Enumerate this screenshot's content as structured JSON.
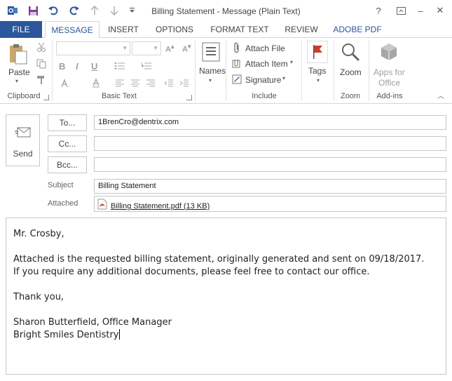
{
  "window": {
    "title": "Billing Statement - Message (Plain Text)",
    "help": "?",
    "minimize": "–",
    "close": "✕"
  },
  "tabs": [
    {
      "label": "FILE"
    },
    {
      "label": "MESSAGE"
    },
    {
      "label": "INSERT"
    },
    {
      "label": "OPTIONS"
    },
    {
      "label": "FORMAT TEXT"
    },
    {
      "label": "REVIEW"
    },
    {
      "label": "ADOBE PDF"
    }
  ],
  "ribbon": {
    "clipboard": {
      "paste": "Paste",
      "group": "Clipboard"
    },
    "basic_text": {
      "bold": "B",
      "italic": "I",
      "underline": "U",
      "group": "Basic Text"
    },
    "names": {
      "label": "Names"
    },
    "include": {
      "attach_file": "Attach File",
      "attach_item": "Attach Item",
      "signature": "Signature",
      "group": "Include"
    },
    "tags": {
      "label": "Tags"
    },
    "zoom": {
      "label": "Zoom",
      "group": "Zoom"
    },
    "addins": {
      "label1": "Apps for",
      "label2": "Office",
      "group": "Add-ins"
    }
  },
  "header": {
    "send": "Send",
    "to_button": "To...",
    "cc_button": "Cc...",
    "bcc_button": "Bcc...",
    "to_value": "1BrenCro@dentrix.com",
    "cc_value": "",
    "bcc_value": "",
    "subject_label": "Subject",
    "subject_value": "Billing Statement",
    "attached_label": "Attached",
    "attachment": "Billing Statement.pdf (13 KB)"
  },
  "body": {
    "line1": "Mr. Crosby,",
    "line2": "Attached is the requested billing statement, originally generated and sent on 09/18/2017.",
    "line3": "If you require any additional documents, please feel free to contact our office.",
    "line4": "Thank you,",
    "line5": "Sharon Butterfield, Office Manager",
    "line6": "Bright Smiles Dentistry"
  },
  "colors": {
    "accent": "#2b579a",
    "pdf": "#d23a2a",
    "tags_flag": "#d23a2a"
  }
}
